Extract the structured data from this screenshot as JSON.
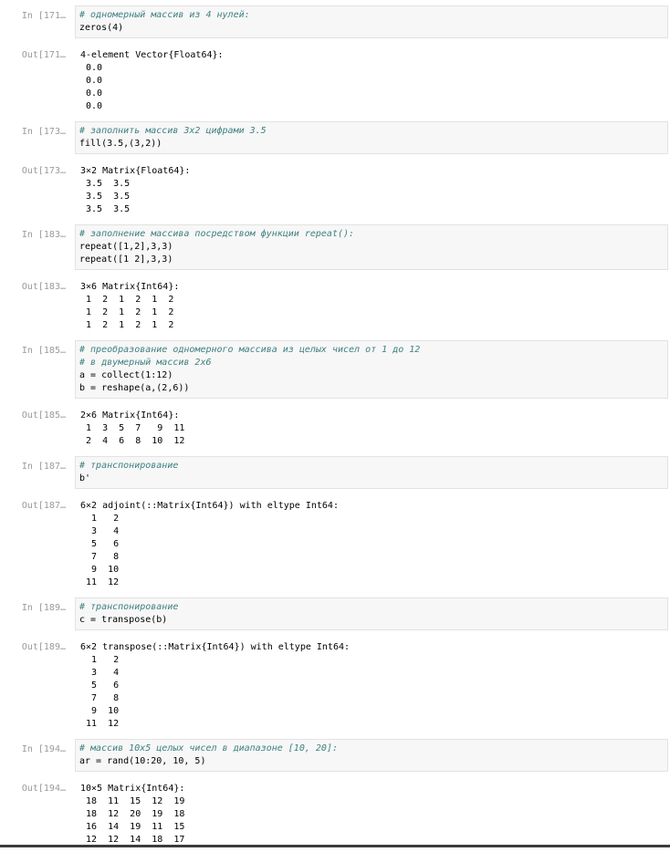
{
  "cells": [
    {
      "in_prompt": "In [171…",
      "out_prompt": "Out[171…",
      "code": [
        "# одномерный массив из 4 нулей:",
        "zeros(4)"
      ],
      "output": [
        "4-element Vector{Float64}:",
        " 0.0",
        " 0.0",
        " 0.0",
        " 0.0"
      ]
    },
    {
      "in_prompt": "In [173…",
      "out_prompt": "Out[173…",
      "code": [
        "# заполнить массив 3х2 цифрами 3.5",
        "fill(3.5,(3,2))"
      ],
      "output": [
        "3×2 Matrix{Float64}:",
        " 3.5  3.5",
        " 3.5  3.5",
        " 3.5  3.5"
      ]
    },
    {
      "in_prompt": "In [183…",
      "out_prompt": "Out[183…",
      "code": [
        "# заполнение массива посредством функции repeat():",
        "repeat([1,2],3,3)",
        "repeat([1 2],3,3)"
      ],
      "output": [
        "3×6 Matrix{Int64}:",
        " 1  2  1  2  1  2",
        " 1  2  1  2  1  2",
        " 1  2  1  2  1  2"
      ]
    },
    {
      "in_prompt": "In [185…",
      "out_prompt": "Out[185…",
      "code": [
        "# преобразование одномерного массива из целых чисел от 1 до 12",
        "# в двумерный массив 2х6",
        "a = collect(1:12)",
        "b = reshape(a,(2,6))"
      ],
      "output": [
        "2×6 Matrix{Int64}:",
        " 1  3  5  7   9  11",
        " 2  4  6  8  10  12"
      ]
    },
    {
      "in_prompt": "In [187…",
      "out_prompt": "Out[187…",
      "code": [
        "# транспонирование",
        "b'"
      ],
      "output": [
        "6×2 adjoint(::Matrix{Int64}) with eltype Int64:",
        "  1   2",
        "  3   4",
        "  5   6",
        "  7   8",
        "  9  10",
        " 11  12"
      ]
    },
    {
      "in_prompt": "In [189…",
      "out_prompt": "Out[189…",
      "code": [
        "# транспонирование",
        "c = transpose(b)"
      ],
      "output": [
        "6×2 transpose(::Matrix{Int64}) with eltype Int64:",
        "  1   2",
        "  3   4",
        "  5   6",
        "  7   8",
        "  9  10",
        " 11  12"
      ]
    },
    {
      "in_prompt": "In [194…",
      "out_prompt": "Out[194…",
      "code": [
        "# массив 10х5 целых чисел в диапазоне [10, 20]:",
        "ar = rand(10:20, 10, 5)"
      ],
      "output": [
        "10×5 Matrix{Int64}:",
        " 18  11  15  12  19",
        " 18  12  20  19  18",
        " 16  14  19  11  15",
        " 12  12  14  18  17"
      ]
    }
  ]
}
